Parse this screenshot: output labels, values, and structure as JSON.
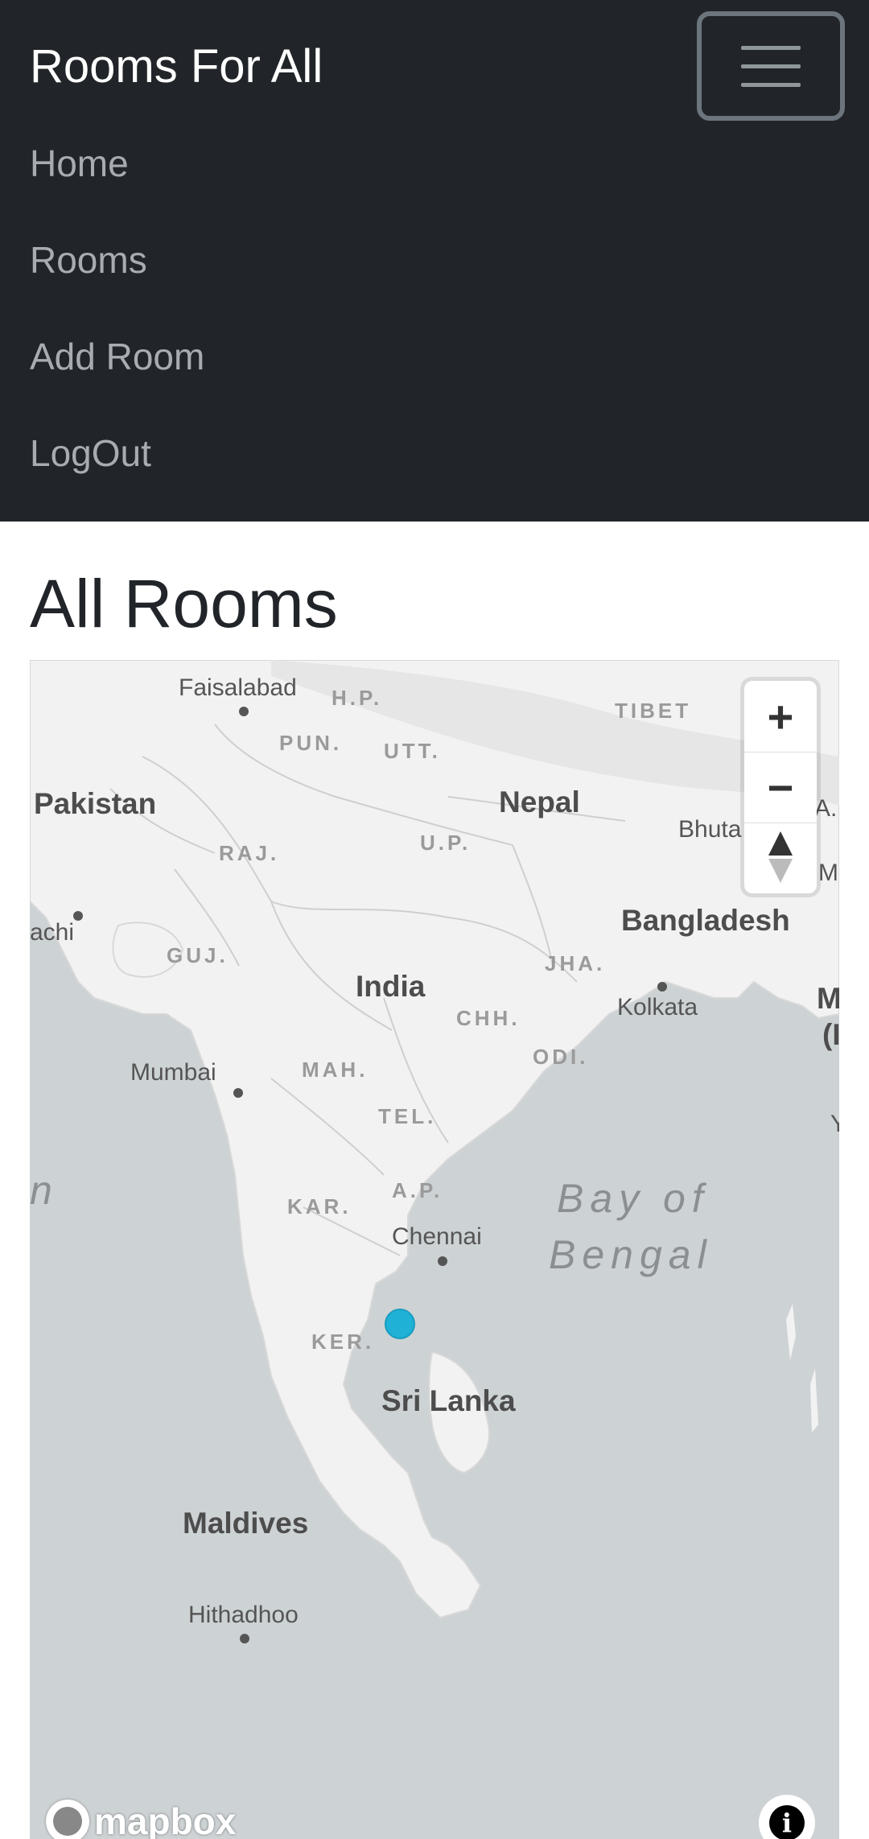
{
  "navbar": {
    "brand": "Rooms For All",
    "toggler_icon": "hamburger-icon",
    "items": [
      {
        "label": "Home"
      },
      {
        "label": "Rooms"
      },
      {
        "label": "Add Room"
      },
      {
        "label": "LogOut"
      }
    ]
  },
  "page": {
    "title": "All Rooms"
  },
  "map": {
    "labels": {
      "faisalabad": "Faisalabad",
      "hp": "H.P.",
      "pun": "PUN.",
      "utt": "UTT.",
      "tibet": "TIBET",
      "pakistan": "Pakistan",
      "nepal": "Nepal",
      "bhutan": "Bhuta",
      "raj": "RAJ.",
      "up": "U.P.",
      "karachi": "achi",
      "guj": "GUJ.",
      "bangladesh": "Bangladesh",
      "jha": "JHA.",
      "india": "India",
      "kolkata": "Kolkata",
      "chh": "CHH.",
      "mumbai": "Mumbai",
      "mah": "MAH.",
      "odi": "ODI.",
      "tel": "TEL.",
      "kar": "KAR.",
      "ap": "A.P.",
      "chennai": "Chennai",
      "bay1": "Bay of",
      "bay2": "Bengal",
      "ker": "KER.",
      "srilanka": "Sri Lanka",
      "maldives": "Maldives",
      "hithadhoo": "Hithadhoo",
      "edge_n": "n",
      "edge_a": "A.",
      "edge_m": "M",
      "edge_m2": "M",
      "edge_paren": "(I",
      "edge_y": "Y"
    },
    "controls": {
      "zoom_in": "+",
      "zoom_out": "−",
      "zoom_in_icon": "plus-icon",
      "zoom_out_icon": "minus-icon",
      "compass_icon": "compass-icon"
    },
    "attribution": {
      "logo": "mapbox",
      "info": "i",
      "info_icon": "info-icon"
    },
    "colors": {
      "water": "#cdd2d4",
      "land": "#f2f2f2",
      "marker": "#1fb1d6"
    }
  }
}
